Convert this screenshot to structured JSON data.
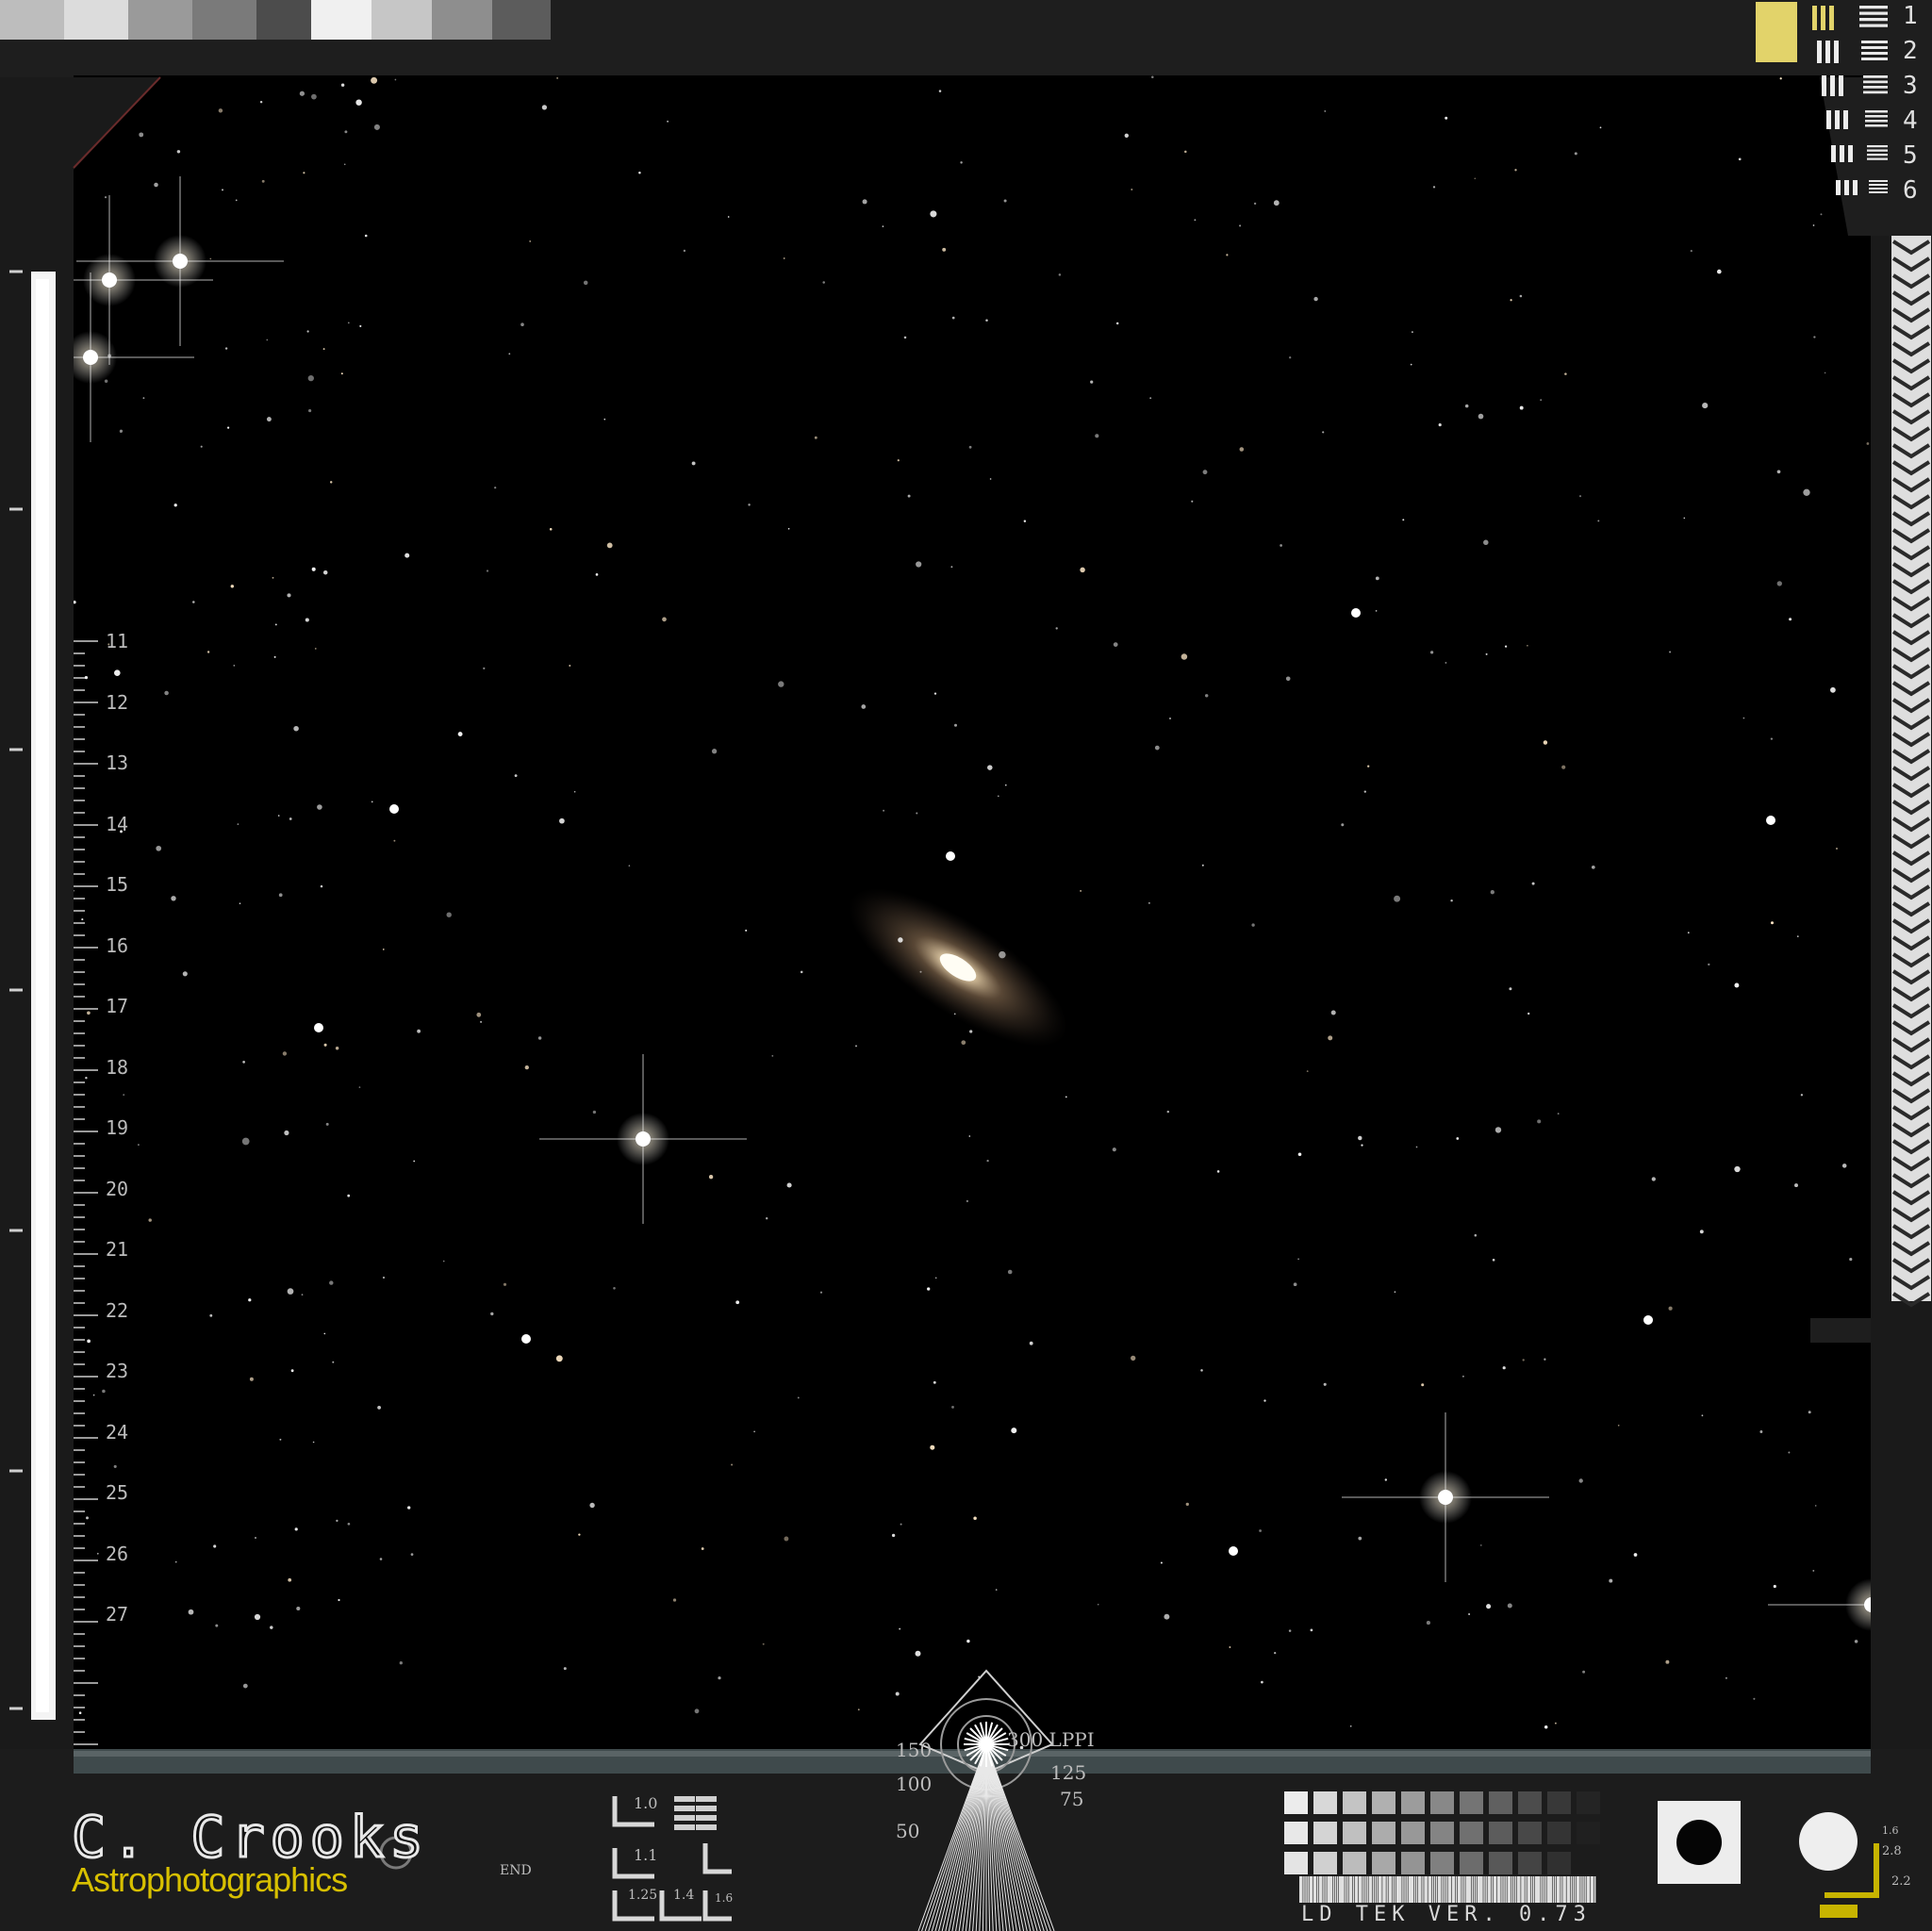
{
  "image": {
    "subject": "spiral-galaxy-starfield",
    "colors": {
      "sky": "#000000",
      "frame": "#1c1c1c",
      "galaxy_core": "#fff6e0",
      "galaxy_halo": "#a08060",
      "logo_accent": "#d8c000",
      "yellow_chip": "#e2d36a"
    }
  },
  "branding": {
    "name": "C. Crooks",
    "tagline": "Astrophotographics"
  },
  "left_scale": {
    "labels": [
      "11",
      "12",
      "13",
      "14",
      "15",
      "16",
      "17",
      "18",
      "19",
      "20",
      "21",
      "22",
      "23",
      "24",
      "25",
      "26",
      "27"
    ]
  },
  "resolution_marks": {
    "labels": [
      "1",
      "2",
      "3",
      "4",
      "5",
      "6"
    ]
  },
  "resolution_target": {
    "labels": {
      "lppi_300": "300 LPPI",
      "v150": "150",
      "v125": "125",
      "v100": "100",
      "v75": "75",
      "v50": "50"
    }
  },
  "small_marks": {
    "end": "END",
    "l10": "1.0",
    "l11": "1.1",
    "l125": "1.25",
    "l14": "1.4",
    "l16": "1.6",
    "r16": "1.6",
    "r28": "2.8",
    "r22": "2.2"
  },
  "footer": {
    "version": "LD TEK VER. 0.73"
  },
  "icons": [
    "target-box-icon",
    "white-disc-icon",
    "barcode-icon",
    "siemens-star-icon"
  ]
}
